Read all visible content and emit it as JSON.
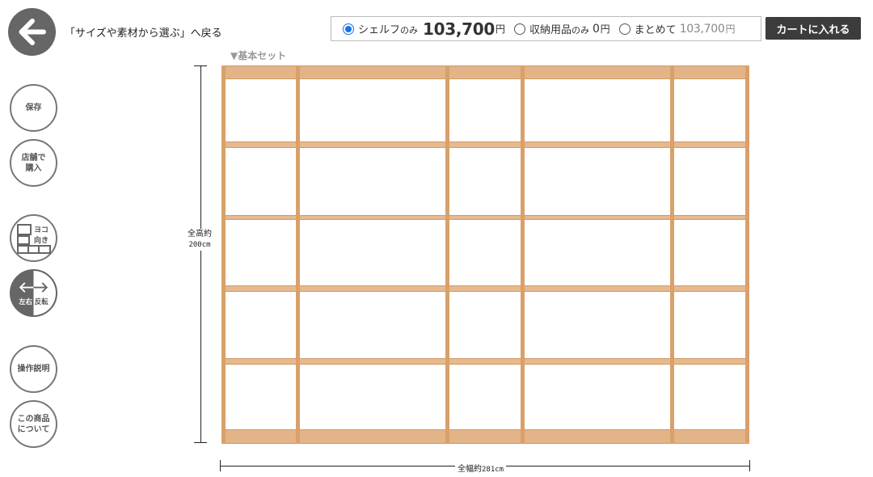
{
  "header": {
    "back_label": "「サイズや素材から選ぶ」へ戻る",
    "options": [
      {
        "label": "シェルフ",
        "label_small": "のみ",
        "price": "103,700",
        "yen": "円",
        "checked": true
      },
      {
        "label": "収納用品",
        "label_small": "のみ",
        "price": "0",
        "yen": "円",
        "checked": false
      },
      {
        "label": "まとめて",
        "label_small": "",
        "price": "103,700",
        "yen": "円",
        "checked": false
      }
    ],
    "cart_label": "カートに入れる"
  },
  "sidebar": {
    "save": "保存",
    "store_line1": "店舗で",
    "store_line2": "購入",
    "orientation_line1": "ヨコ",
    "orientation_line2": "向き",
    "flip_label": "左右反転",
    "help": "操作説明",
    "about_line1": "この商品",
    "about_line2": "について"
  },
  "shelf": {
    "set_label": "▼基本セット",
    "height_label": "全高約",
    "height_value": "200cm",
    "width_label": "全幅約",
    "width_value": "281cm"
  },
  "colors": {
    "accent": "#1a73e8",
    "wood": "#e7b98d",
    "button_dark": "#3c3c3c"
  }
}
